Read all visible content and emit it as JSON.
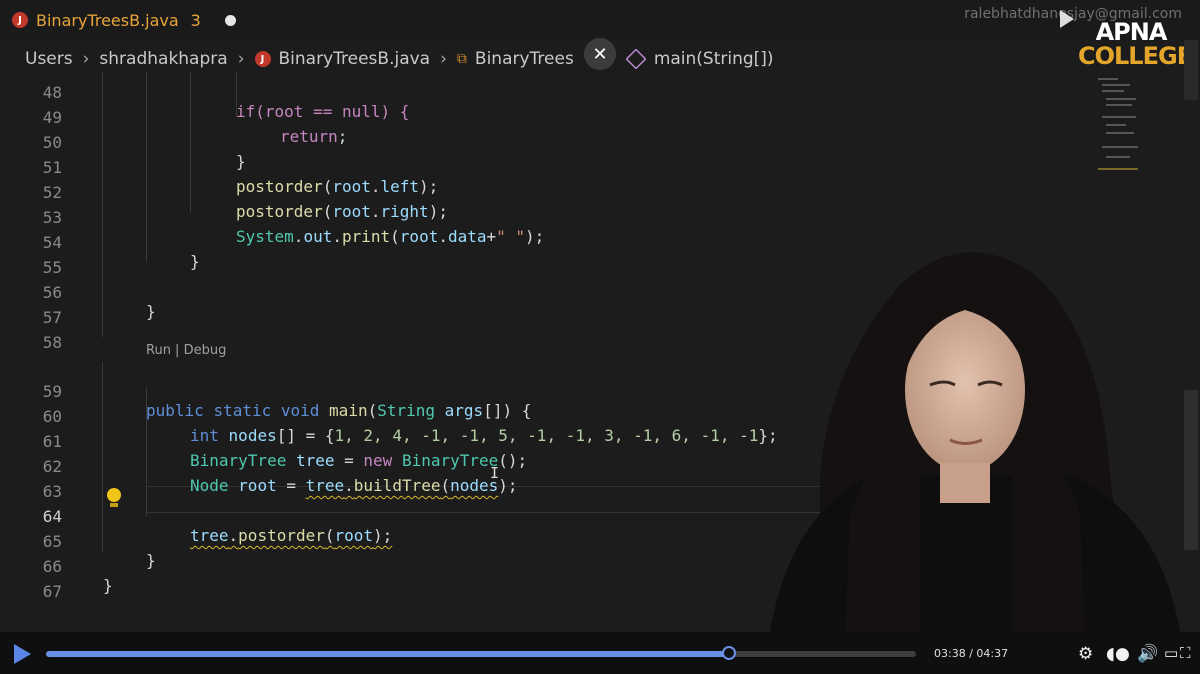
{
  "tab": {
    "icon": "J",
    "filename": "BinaryTreesB.java",
    "problems": "3"
  },
  "watermark_email": "ralebhatdhanesjay@gmail.com",
  "breadcrumb": [
    "Users",
    "shradhakhapra",
    "BinaryTreesB.java",
    "BinaryTrees",
    "main(String[])"
  ],
  "close_label": "✕",
  "logo": {
    "top": "APNA",
    "bottom": "COLLEGE"
  },
  "codelens": "Run | Debug",
  "lines": [
    {
      "n": "48"
    },
    {
      "n": "49"
    },
    {
      "n": "50"
    },
    {
      "n": "51"
    },
    {
      "n": "52"
    },
    {
      "n": "53"
    },
    {
      "n": "54"
    },
    {
      "n": "55"
    },
    {
      "n": "56"
    },
    {
      "n": "57"
    },
    {
      "n": "58"
    },
    {
      "n": "59"
    },
    {
      "n": "60"
    },
    {
      "n": "61"
    },
    {
      "n": "62"
    },
    {
      "n": "63"
    },
    {
      "n": "64"
    },
    {
      "n": "65"
    },
    {
      "n": "66"
    },
    {
      "n": "67"
    }
  ],
  "code": {
    "l48": [
      "if(root == null) {"
    ],
    "l49": [
      "return",
      ";"
    ],
    "l50": [
      "}"
    ],
    "l51": [
      "postorder",
      "(",
      "root",
      ".",
      "left",
      ");"
    ],
    "l52": [
      "postorder",
      "(",
      "root",
      ".",
      "right",
      ");"
    ],
    "l53": [
      "System",
      ".",
      "out",
      ".",
      "print",
      "(",
      "root",
      ".",
      "data",
      "+",
      "\" \"",
      ");"
    ],
    "l54": [
      "}"
    ],
    "l56": [
      "}"
    ],
    "l59": [
      "public",
      " ",
      "static",
      " ",
      "void",
      " ",
      "main",
      "(",
      "String",
      " ",
      "args",
      "[]) {"
    ],
    "l60": [
      "int",
      " ",
      "nodes",
      "[] = {",
      "1, 2, 4, -1, -1, 5, -1, -1, 3, -1, 6, -1, -1",
      "};"
    ],
    "l61": [
      "BinaryTree",
      " ",
      "tree",
      " = ",
      "new",
      " ",
      "BinaryTree",
      "();"
    ],
    "l62": [
      "Node",
      " ",
      "root",
      " = ",
      "tree",
      ".",
      "buildTree",
      "(",
      "nodes",
      ");"
    ],
    "l64": [
      "tree",
      ".",
      "postorder",
      "(",
      "root",
      ");"
    ],
    "l65": [
      "}"
    ],
    "l66": [
      "}"
    ]
  },
  "player": {
    "current": "03:38",
    "total": "04:37",
    "progress": 0.785,
    "time_sep": " / "
  },
  "colors": {
    "accent": "#6a8fe6",
    "tab_text": "#e8a43a",
    "logo_gold": "#e3a52a"
  }
}
